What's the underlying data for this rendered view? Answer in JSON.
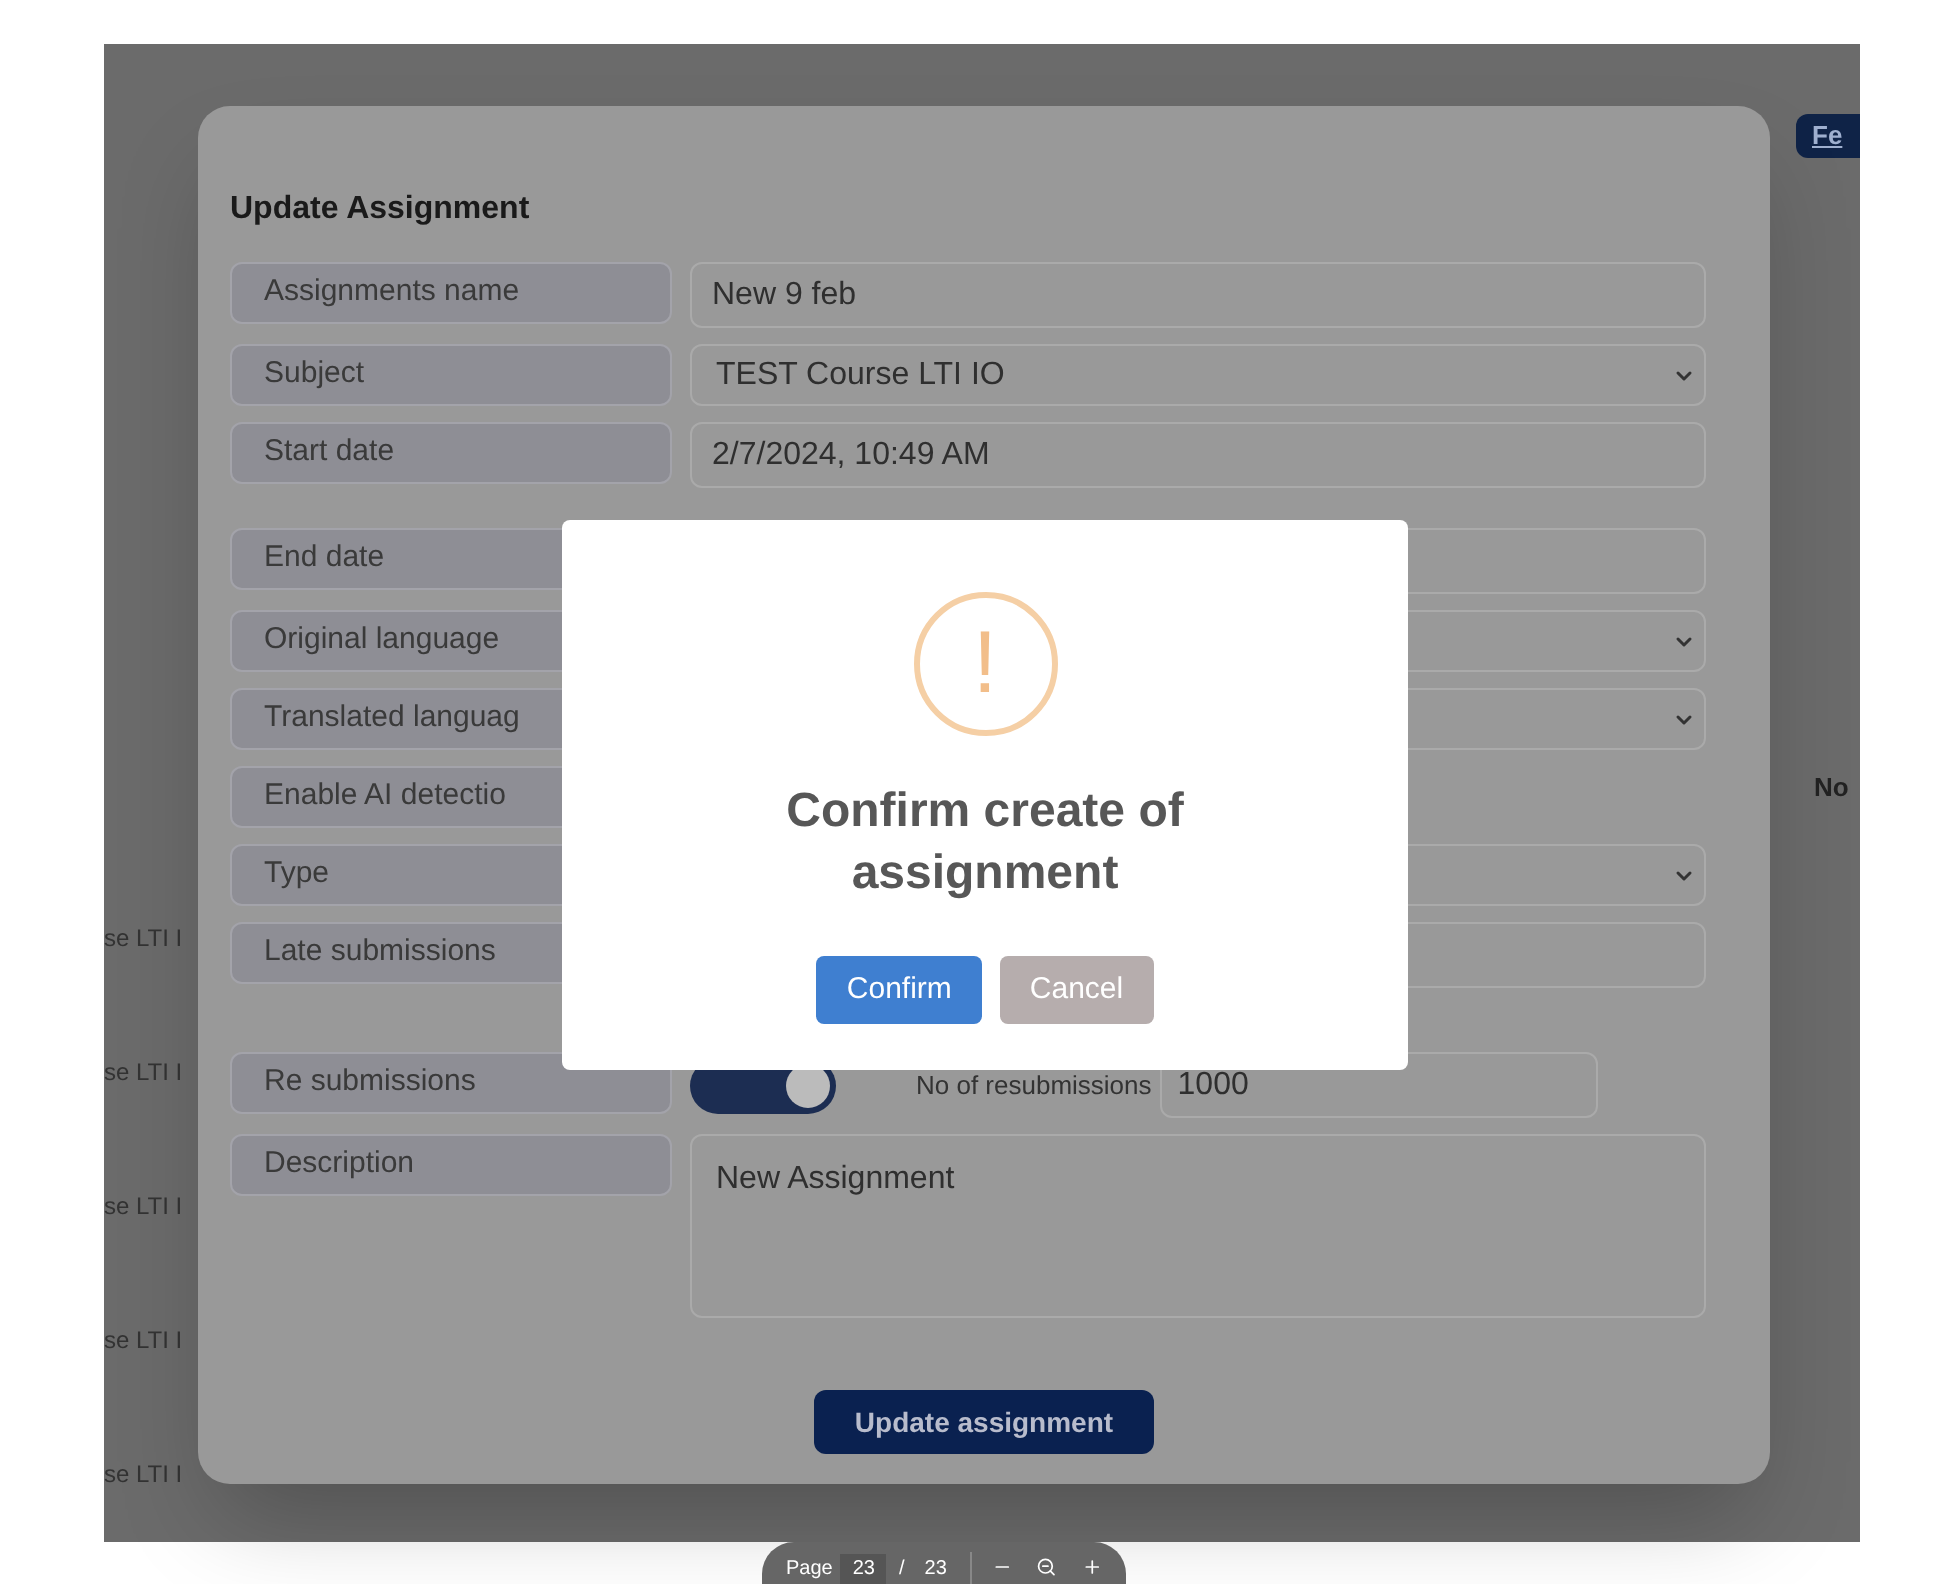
{
  "background": {
    "feedback_button": "Fe",
    "column_text": "No",
    "row_texts": [
      "se LTI I",
      "se LTI I",
      "se LTI I",
      "se LTI I",
      "se LTI I"
    ]
  },
  "form": {
    "title": "Update Assignment",
    "rows": [
      {
        "kind": "text",
        "label": "Assignments name",
        "value": "New 9 feb"
      },
      {
        "kind": "select",
        "label": "Subject",
        "value": "TEST Course LTI IO"
      },
      {
        "kind": "text",
        "label": "Start date",
        "value": "2/7/2024, 10:49 AM"
      },
      {
        "kind": "text",
        "label": "End date"
      },
      {
        "kind": "select",
        "label": "Original language"
      },
      {
        "kind": "select",
        "label": "Translated languag"
      },
      {
        "kind": "blank",
        "label": "Enable AI detectio"
      },
      {
        "kind": "select",
        "label": "Type"
      },
      {
        "kind": "text",
        "label": "Late submissions"
      },
      {
        "kind": "toggle",
        "label": "Re submissions",
        "on": true,
        "extra_label": "No of resubmissions",
        "extra_value": "1000"
      },
      {
        "kind": "textarea",
        "label": "Description",
        "value": "New Assignment"
      }
    ],
    "submit": "Update assignment"
  },
  "alert": {
    "glyph": "!",
    "title": "Confirm create of assignment",
    "buttons": [
      {
        "kind": "primary",
        "label": "Confirm"
      },
      {
        "kind": "secondary",
        "label": "Cancel"
      }
    ]
  },
  "pdf_toolbar": {
    "page_label": "Page",
    "page": "23",
    "separator": "/",
    "total": "23"
  }
}
